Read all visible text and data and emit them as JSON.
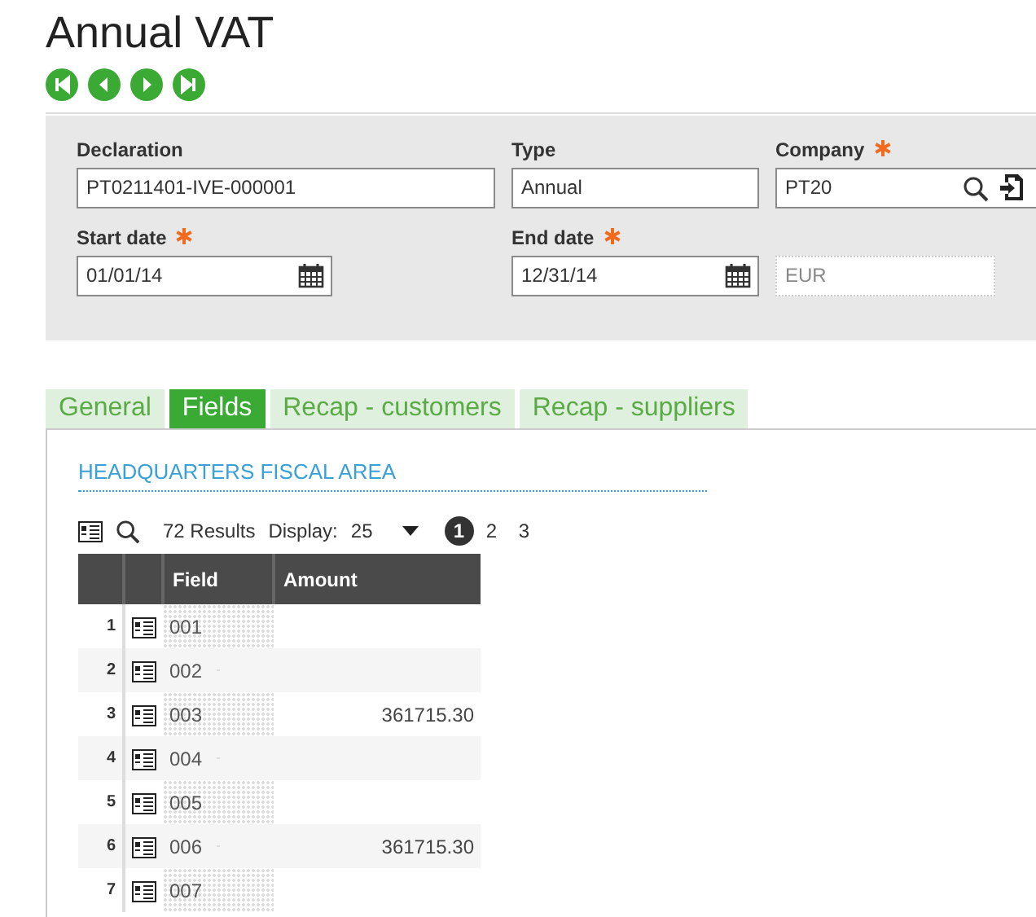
{
  "title": "Annual VAT",
  "nav_buttons": [
    {
      "kind": "first"
    },
    {
      "kind": "previous"
    },
    {
      "kind": "next"
    },
    {
      "kind": "last"
    }
  ],
  "header": {
    "fields": [
      {
        "label": "Declaration",
        "value": "PT0211401-IVE-000001",
        "required": false,
        "kind": "text"
      },
      {
        "label": "Type",
        "value": "Annual",
        "required": false,
        "kind": "text"
      },
      {
        "label": "Company",
        "value": "PT20",
        "required": true,
        "kind": "lookup"
      },
      {
        "label": "Start date",
        "value": "01/01/14",
        "required": true,
        "kind": "date"
      },
      {
        "label": "End date",
        "value": "12/31/14",
        "required": true,
        "kind": "date"
      },
      {
        "value": "EUR",
        "kind": "readonly"
      }
    ]
  },
  "tabs": [
    {
      "label": "General",
      "selected": false
    },
    {
      "label": "Fields",
      "selected": true
    },
    {
      "label": "Recap - customers",
      "selected": false
    },
    {
      "label": "Recap - suppliers",
      "selected": false
    }
  ],
  "section_title": "HEADQUARTERS FISCAL AREA",
  "grid": {
    "results": "72 Results",
    "display_label": "Display:",
    "display_value": "25",
    "pages": [
      {
        "label": "1",
        "selected": true
      },
      {
        "label": "2",
        "selected": false
      },
      {
        "label": "3",
        "selected": false
      }
    ],
    "columns": [
      "Field",
      "Amount"
    ],
    "rows": [
      {
        "num": "1",
        "field": "001",
        "amount": ""
      },
      {
        "num": "2",
        "field": "002",
        "amount": ""
      },
      {
        "num": "3",
        "field": "003",
        "amount": "361715.30"
      },
      {
        "num": "4",
        "field": "004",
        "amount": ""
      },
      {
        "num": "5",
        "field": "005",
        "amount": ""
      },
      {
        "num": "6",
        "field": "006",
        "amount": "361715.30"
      },
      {
        "num": "7",
        "field": "007",
        "amount": ""
      }
    ]
  }
}
